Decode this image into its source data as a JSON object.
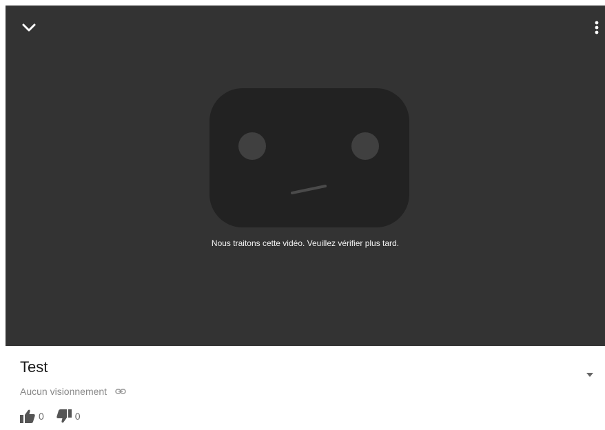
{
  "player": {
    "background_color": "#333333",
    "collapse_icon": "chevron-down-icon",
    "menu_icon": "more-vert-icon",
    "placeholder_icon": "sad-robot-face-icon",
    "message": "Nous traitons cette vidéo. Veuillez vérifier plus tard."
  },
  "video": {
    "title": "Test",
    "views": "Aucun visionnement",
    "share_icon": "link-icon",
    "expand_icon": "caret-down-icon",
    "likes": "0",
    "dislikes": "0",
    "like_icon": "thumb-up-icon",
    "dislike_icon": "thumb-down-icon"
  }
}
